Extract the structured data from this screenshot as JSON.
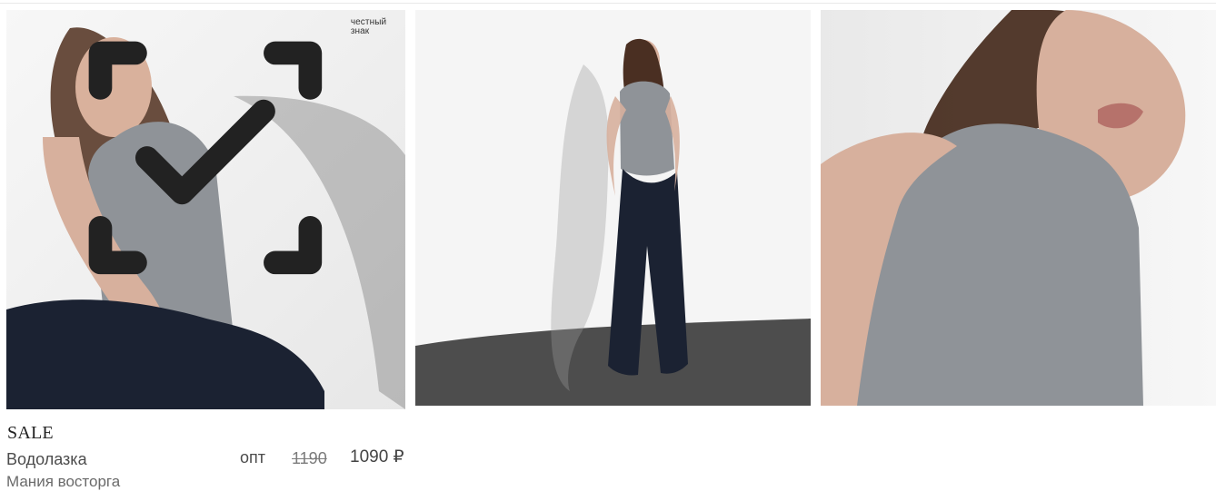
{
  "badge": {
    "text": "честный знак",
    "icon": "checkmark-scan-icon"
  },
  "product": {
    "sale_label": "SALE",
    "title": "Водолазка",
    "brand": "Мания восторга",
    "price_mode": "опт",
    "old_price": "1190",
    "price": "1090 ₽"
  },
  "images": [
    {
      "name": "photo-1",
      "alt": "Product photo 1"
    },
    {
      "name": "photo-2",
      "alt": "Product photo 2"
    },
    {
      "name": "photo-3",
      "alt": "Product photo 3"
    }
  ],
  "colors": {
    "background": "#ffffff",
    "text_dark": "#222222",
    "text_muted": "#6a6a6a",
    "photo_bg": "#f4f4f4",
    "top_gray": "#8f9398",
    "pants_navy": "#1b2232",
    "floor_gray": "#4d4d4d"
  }
}
